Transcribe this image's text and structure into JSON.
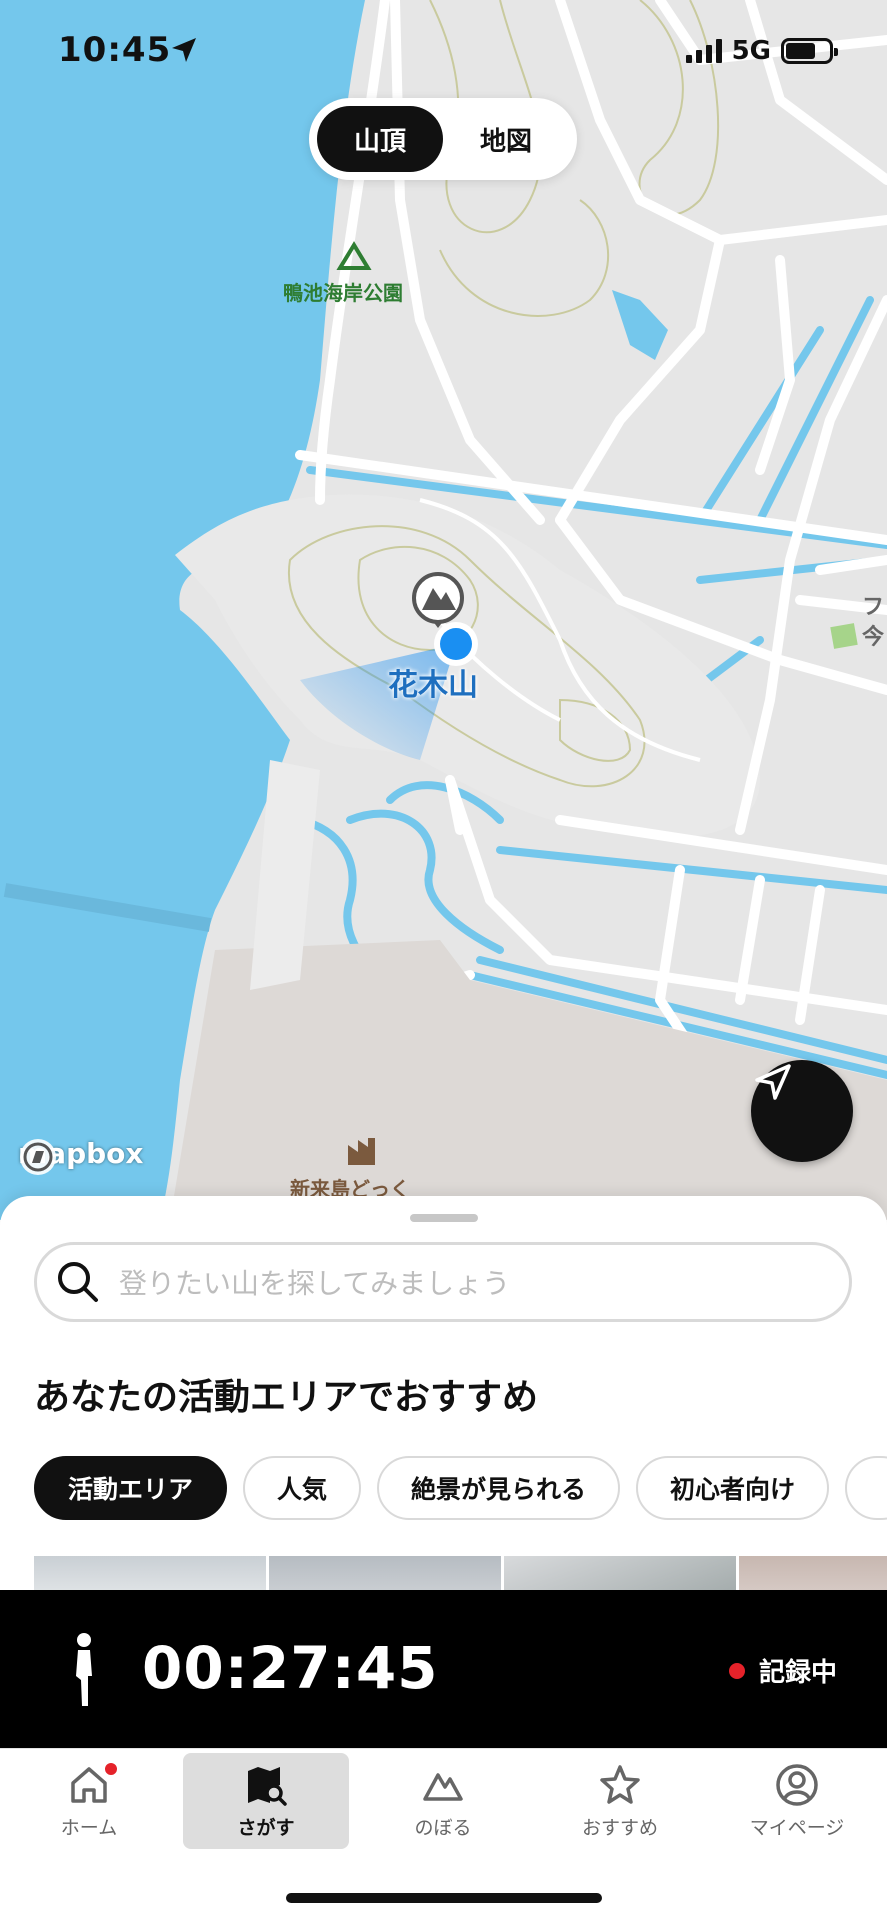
{
  "status_bar": {
    "time": "10:45",
    "network": "5G"
  },
  "segment": {
    "options": [
      "山頂",
      "地図"
    ],
    "selected": "山頂"
  },
  "map": {
    "labels": {
      "park": "鴨池海岸公園",
      "peak": "花木山",
      "dock": "新来島どっく",
      "edge_top": "ファ",
      "edge_bottom": "今"
    },
    "attribution": "mapbox",
    "colors": {
      "water": "#74c7ec",
      "land": "#e6e6e6",
      "road": "#ffffff",
      "contour": "#c9ca9e",
      "user": "#1a8ff2"
    }
  },
  "search": {
    "placeholder": "登りたい山を探してみましょう"
  },
  "recommend": {
    "title": "あなたの活動エリアでおすすめ",
    "chips": [
      "活動エリア",
      "人気",
      "絶景が見られる",
      "初心者向け"
    ],
    "active_chip": "活動エリア"
  },
  "recording": {
    "elapsed": "00:27:45",
    "status": "記録中"
  },
  "tabs": [
    {
      "label": "ホーム",
      "icon": "home-icon",
      "badge": true
    },
    {
      "label": "さがす",
      "icon": "map-search-icon",
      "active": true
    },
    {
      "label": "のぼる",
      "icon": "mountain-icon"
    },
    {
      "label": "おすすめ",
      "icon": "star-icon"
    },
    {
      "label": "マイページ",
      "icon": "profile-icon"
    }
  ]
}
